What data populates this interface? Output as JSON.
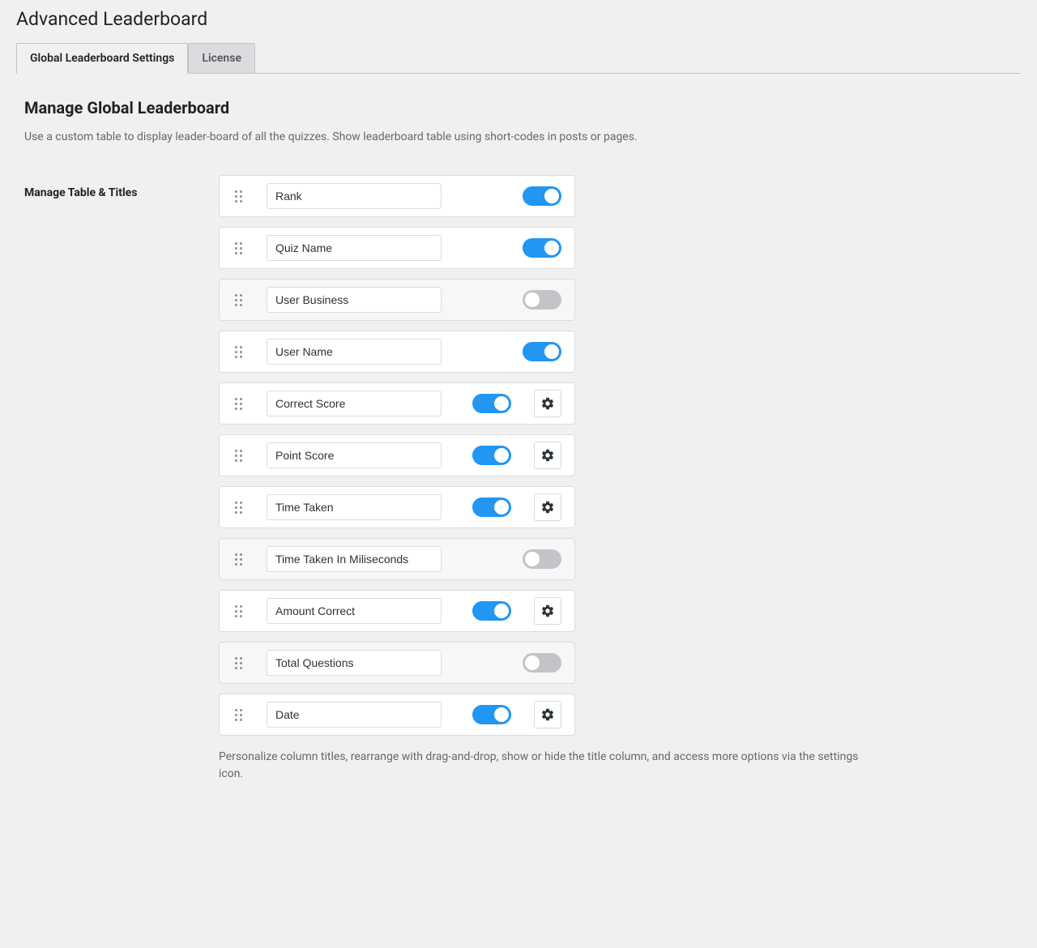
{
  "page_title": "Advanced Leaderboard",
  "tabs": [
    {
      "label": "Global Leaderboard Settings",
      "active": true
    },
    {
      "label": "License",
      "active": false
    }
  ],
  "section": {
    "title": "Manage Global Leaderboard",
    "desc": "Use a custom table to display leader-board of all the quizzes. Show leaderboard table using short-codes in posts or pages."
  },
  "row_label": "Manage Table & Titles",
  "fields": [
    {
      "value": "Rank",
      "enabled": true,
      "has_settings": false
    },
    {
      "value": "Quiz Name",
      "enabled": true,
      "has_settings": false
    },
    {
      "value": "User Business",
      "enabled": false,
      "has_settings": false
    },
    {
      "value": "User Name",
      "enabled": true,
      "has_settings": false
    },
    {
      "value": "Correct Score",
      "enabled": true,
      "has_settings": true
    },
    {
      "value": "Point Score",
      "enabled": true,
      "has_settings": true
    },
    {
      "value": "Time Taken",
      "enabled": true,
      "has_settings": true
    },
    {
      "value": "Time Taken In Miliseconds",
      "enabled": false,
      "has_settings": false
    },
    {
      "value": "Amount Correct",
      "enabled": true,
      "has_settings": true
    },
    {
      "value": "Total Questions",
      "enabled": false,
      "has_settings": false
    },
    {
      "value": "Date",
      "enabled": true,
      "has_settings": true
    }
  ],
  "help_text": "Personalize column titles, rearrange with drag-and-drop, show or hide the title column, and access more options via the settings icon."
}
